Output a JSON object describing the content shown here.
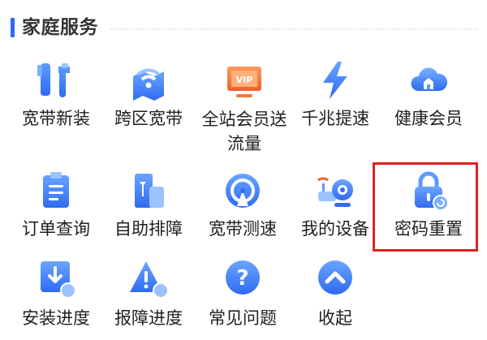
{
  "section": {
    "title": "家庭服务"
  },
  "services": [
    {
      "label": "宽带新装",
      "icon": "tools-icon"
    },
    {
      "label": "跨区宽带",
      "icon": "wifi-map-icon"
    },
    {
      "label": "全站会员送流量",
      "label_lines": [
        "全站会员送",
        "流量"
      ],
      "icon": "vip-tv-icon"
    },
    {
      "label": "千兆提速",
      "icon": "lightning-icon"
    },
    {
      "label": "健康会员",
      "icon": "cloud-home-icon"
    },
    {
      "label": "订单查询",
      "icon": "clipboard-icon"
    },
    {
      "label": "自助排障",
      "icon": "repair-phone-icon"
    },
    {
      "label": "宽带测速",
      "icon": "speedometer-icon"
    },
    {
      "label": "我的设备",
      "icon": "router-camera-icon"
    },
    {
      "label": "密码重置",
      "icon": "lock-reset-icon"
    },
    {
      "label": "安装进度",
      "icon": "install-progress-icon"
    },
    {
      "label": "报障进度",
      "icon": "fault-warning-icon"
    },
    {
      "label": "常见问题",
      "icon": "question-icon"
    },
    {
      "label": "收起",
      "icon": "chevron-up-icon"
    }
  ],
  "highlighted_item": "密码重置",
  "colors": {
    "accent": "#2f6bf2",
    "icon_blue": "#3d7cf4",
    "vip_orange": "#f07a3a",
    "highlight_red": "#e02020"
  }
}
